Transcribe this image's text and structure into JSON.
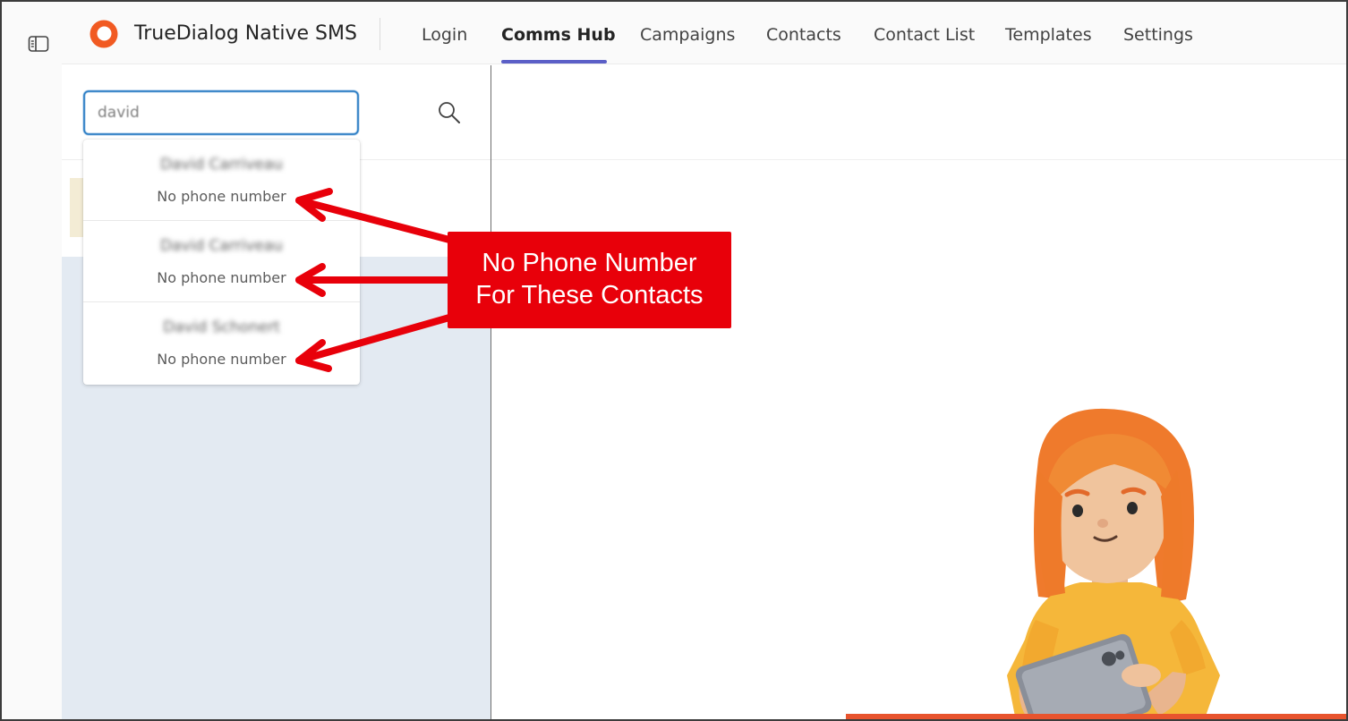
{
  "app": {
    "title": "TrueDialog Native SMS",
    "brand_color": "#f15a22"
  },
  "nav": {
    "items": [
      {
        "label": "Login"
      },
      {
        "label": "Comms Hub"
      },
      {
        "label": "Campaigns"
      },
      {
        "label": "Contacts"
      },
      {
        "label": "Contact List"
      },
      {
        "label": "Templates"
      },
      {
        "label": "Settings"
      }
    ],
    "active": "Comms Hub",
    "accent_color": "#5b5fc7"
  },
  "search": {
    "value": "david"
  },
  "results": [
    {
      "name": "David Carriveau",
      "subtitle": "No phone number"
    },
    {
      "name": "David Carriveau",
      "subtitle": "No phone number"
    },
    {
      "name": "David Schonert",
      "subtitle": "No phone number"
    }
  ],
  "annotation": {
    "line1": "No Phone Number",
    "line2": "For These Contacts",
    "color": "#e8000a"
  },
  "icons": {
    "sidebar_toggle": "sidebar-toggle-icon",
    "search": "search-icon",
    "logo": "truedialog-logo"
  }
}
